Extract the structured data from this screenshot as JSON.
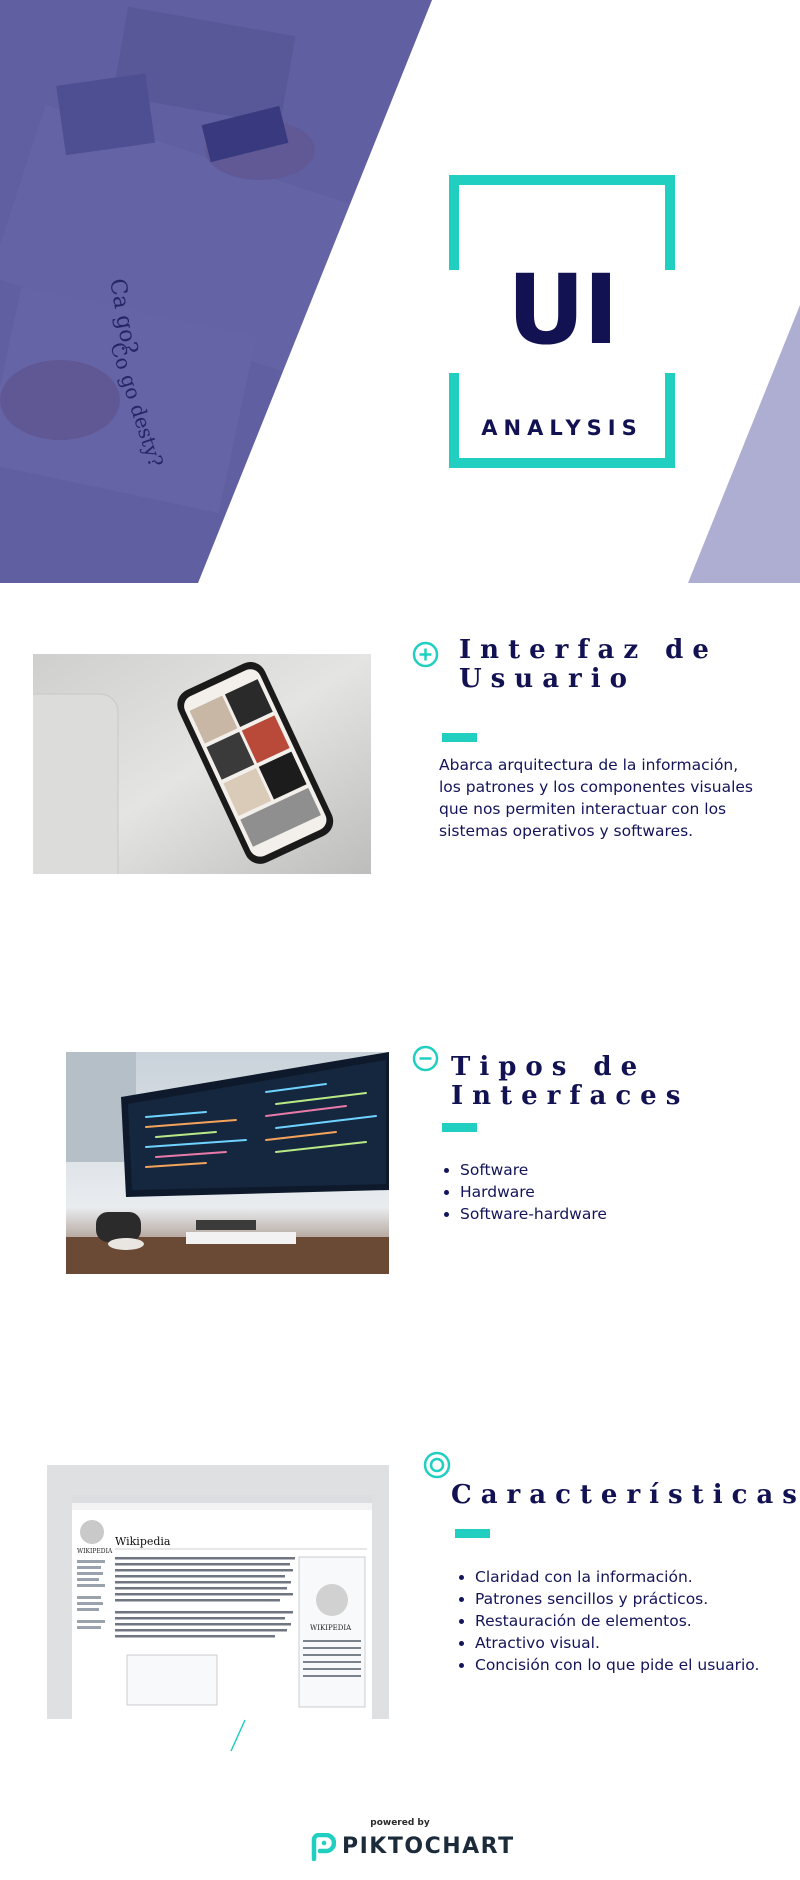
{
  "hero": {
    "title": "UI",
    "subtitle": "ANALYSIS",
    "colors": {
      "navy": "#121253",
      "teal": "#21cfc0",
      "lavender": "#aeaed3",
      "overlay": "#3c3d94"
    }
  },
  "sections": [
    {
      "icon": "plus-circle-icon",
      "title_line1": "Interfaz de",
      "title_line2": "Usuario",
      "text": "Abarca arquitectura de la información, los patrones y los componentes visuales que nos permiten interactuar  con los sistemas operativos y softwares.",
      "image": "smartphone-photo"
    },
    {
      "icon": "minus-circle-icon",
      "title_line1": "Tipos de",
      "title_line2": "Interfaces",
      "items": [
        "Software",
        "Hardware",
        "Software-hardware"
      ],
      "image": "monitor-code-photo"
    },
    {
      "icon": "target-icon",
      "title_line1": "Características",
      "items": [
        "Claridad con la información.",
        "Patrones sencillos y prácticos.",
        "Restauración de elementos.",
        "Atractivo visual.",
        "Concisión con lo que pide el usuario."
      ],
      "image": "wikipedia-screenshot",
      "screenshot": {
        "site": "Wikipedia",
        "heading": "Wikipedia",
        "logo": "WIKIPEDIA"
      }
    }
  ],
  "footer": {
    "powered_by": "powered by",
    "brand": "PIKTOCHART"
  }
}
